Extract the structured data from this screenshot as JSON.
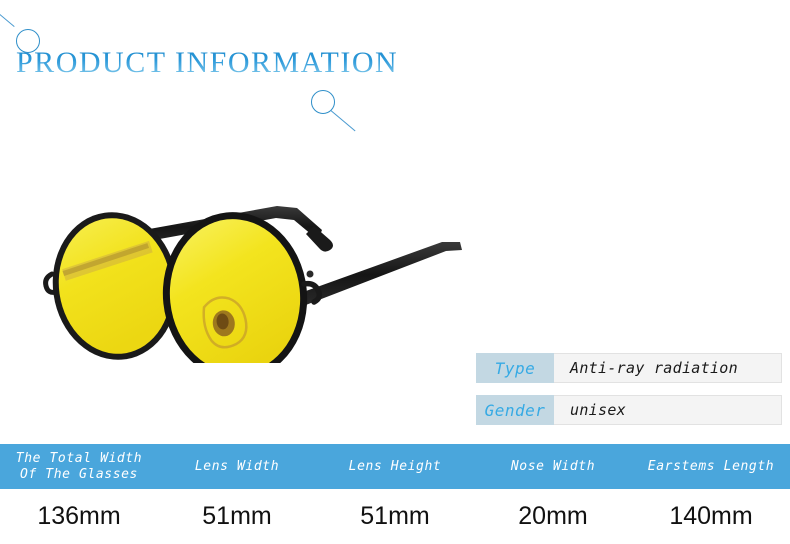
{
  "page": {
    "background_color": "#ffffff",
    "accent_blue": "#4aa6dc",
    "label_blue": "#36aae4",
    "label_bg": "#c3d8e3"
  },
  "header": {
    "title": "PRODUCT  INFORMATION"
  },
  "decorations": [
    {
      "name": "circle-top-left",
      "type": "circle"
    },
    {
      "name": "line-top-left",
      "type": "line"
    },
    {
      "name": "circle-mid",
      "type": "circle"
    },
    {
      "name": "line-mid",
      "type": "line"
    }
  ],
  "product_image": {
    "name": "round-sunglasses",
    "lens_color": "#f2e21c",
    "frame_color": "#151515",
    "alt": "Round metal frame sunglasses with yellow tinted lenses"
  },
  "properties": [
    {
      "label": "Type",
      "value": "Anti-ray radiation"
    },
    {
      "label": "Gender",
      "value": "unisex"
    }
  ],
  "dimensions": {
    "headers": [
      "The Total Width\nOf The Glasses",
      "Lens Width",
      "Lens Height",
      "Nose Width",
      "Earstems Length"
    ],
    "values": [
      "136mm",
      "51mm",
      "51mm",
      "20mm",
      "140mm"
    ]
  }
}
